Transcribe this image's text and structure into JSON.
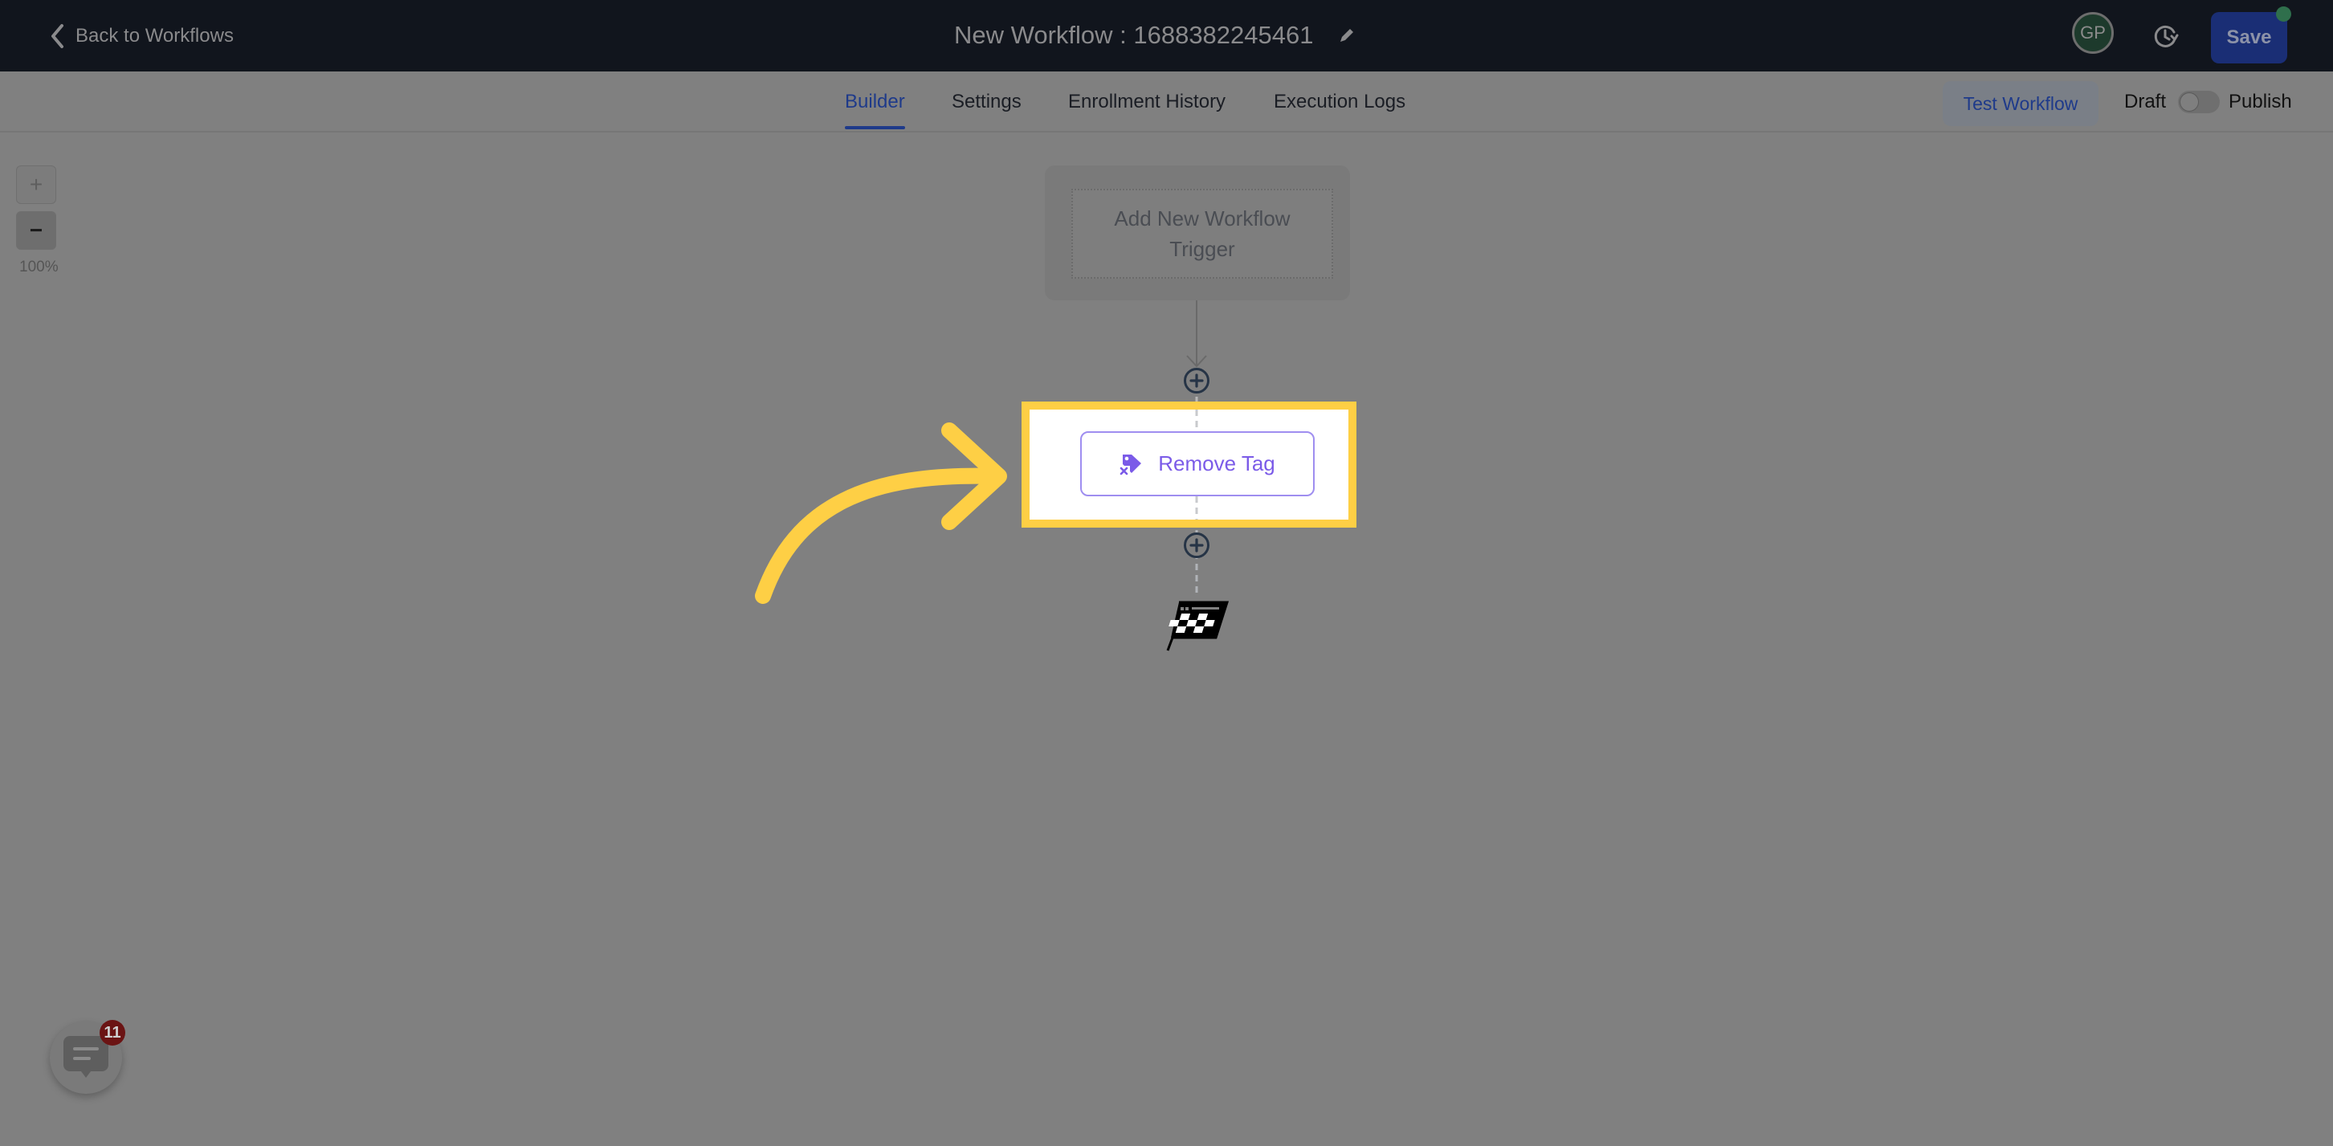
{
  "header": {
    "back_label": "Back to Workflows",
    "title": "New Workflow : 1688382245461",
    "avatar_initials": "GP",
    "save_label": "Save",
    "icons": {
      "back": "chevron-left-icon",
      "edit": "pencil-icon",
      "history": "history-icon"
    }
  },
  "tabs": [
    {
      "label": "Builder",
      "active": true
    },
    {
      "label": "Settings",
      "active": false
    },
    {
      "label": "Enrollment History",
      "active": false
    },
    {
      "label": "Execution Logs",
      "active": false
    }
  ],
  "actions": {
    "test_label": "Test Workflow",
    "draft_label": "Draft",
    "publish_label": "Publish",
    "publish_toggle_on": false
  },
  "canvas": {
    "zoom_in_label": "+",
    "zoom_out_label": "−",
    "zoom_level": "100%",
    "trigger_label": "Add New Workflow Trigger",
    "action_node_label": "Remove Tag",
    "action_node_icon": "tag-remove-icon",
    "end_icon": "checkered-flag-icon"
  },
  "chat": {
    "badge_count": "11",
    "icon": "chat-icon"
  },
  "colors": {
    "header_bg": "#11151d",
    "overlay_bg": "#808080",
    "accent_blue": "#1e3a8a",
    "action_purple": "#7b5be8",
    "highlight_yellow": "#fecf45",
    "badge_red": "#6b1414"
  }
}
